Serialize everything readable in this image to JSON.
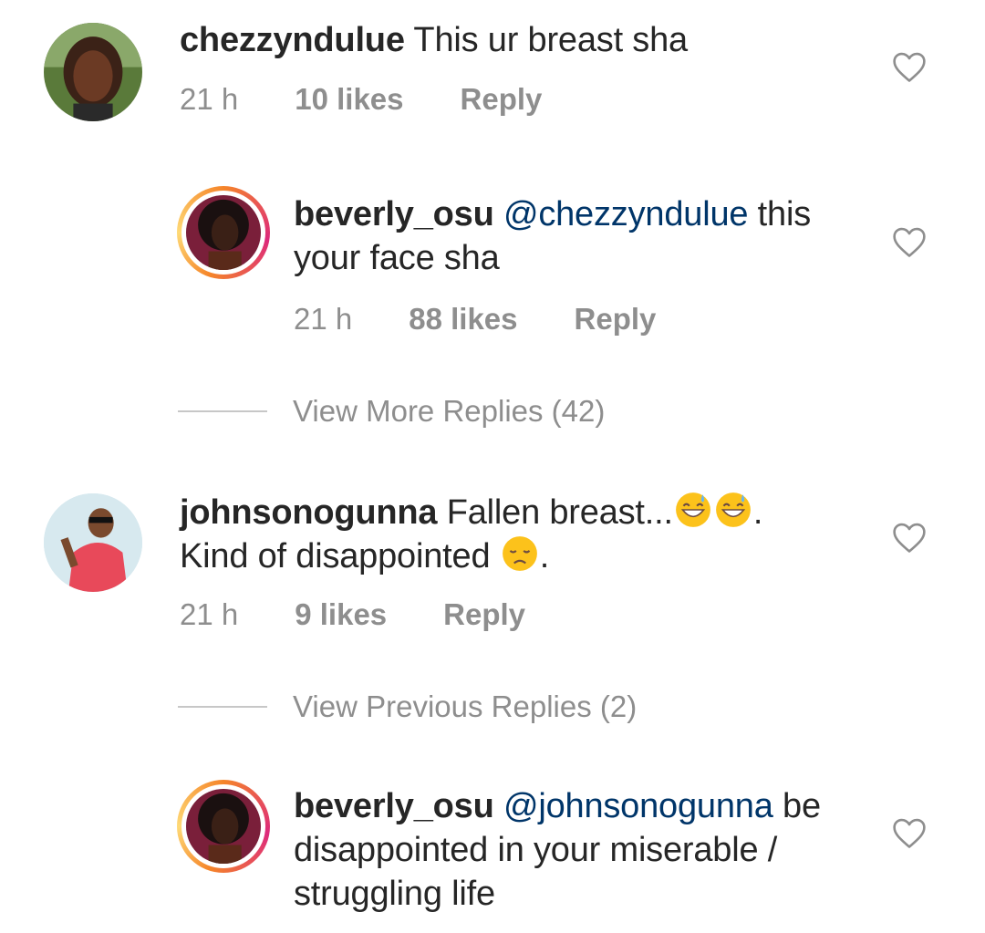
{
  "comments": [
    {
      "username": "chezzyndulue",
      "text": " This ur breast sha",
      "time": "21 h",
      "likes": "10 likes",
      "reply": "Reply"
    },
    {
      "username": "beverly_osu",
      "mention": "@chezzyndulue",
      "text_line1": " this",
      "text_line2": "your face sha",
      "time": "21 h",
      "likes": "88 likes",
      "reply": "Reply"
    },
    {
      "username": "johnsonogunna",
      "text_line1": " Fallen breast...",
      "text_line1_end": ".",
      "text_line2": "Kind of disappointed ",
      "text_line2_end": ".",
      "time": "21 h",
      "likes": "9 likes",
      "reply": "Reply"
    },
    {
      "username": "beverly_osu",
      "mention": "@johnsonogunna",
      "text_line1": " be",
      "text_line2": "disappointed in your miserable /",
      "text_line3": "struggling life"
    }
  ],
  "view_more_replies": "View More Replies (42)",
  "view_previous_replies": "View Previous Replies (2)",
  "icons": {
    "heart": "heart-outline-icon",
    "sweat_smile": "grinning-face-with-sweat-emoji",
    "disappointed": "disappointed-face-emoji"
  },
  "colors": {
    "text": "#262626",
    "meta": "#8e8e8e",
    "mention": "#003569",
    "story_ring": "#dd2a7b"
  }
}
